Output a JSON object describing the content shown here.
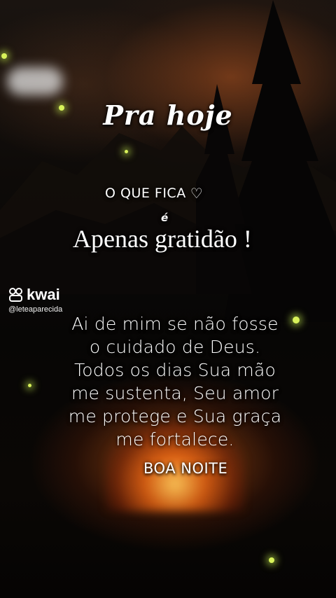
{
  "title": "Pra hoje",
  "subtitle": {
    "line1": "O QUE FICA",
    "heart_icon": "white-heart-icon",
    "line2": "é",
    "line3": "Apenas gratidão !"
  },
  "poem": {
    "lines": [
      "Ai de mim se não fosse",
      "o cuidado de Deus.",
      "Todos os dias Sua mão",
      "me sustenta, Seu amor",
      "me protege e Sua graça",
      "me fortalece."
    ]
  },
  "closing": "BOA NOITE",
  "watermark": {
    "brand": "kwai",
    "handle": "@leteaparecida",
    "logo_icon": "kwai-logo-icon"
  },
  "colors": {
    "text": "#ffffff",
    "firefly": "#d8f25a",
    "fire": "#ff8a2a"
  }
}
